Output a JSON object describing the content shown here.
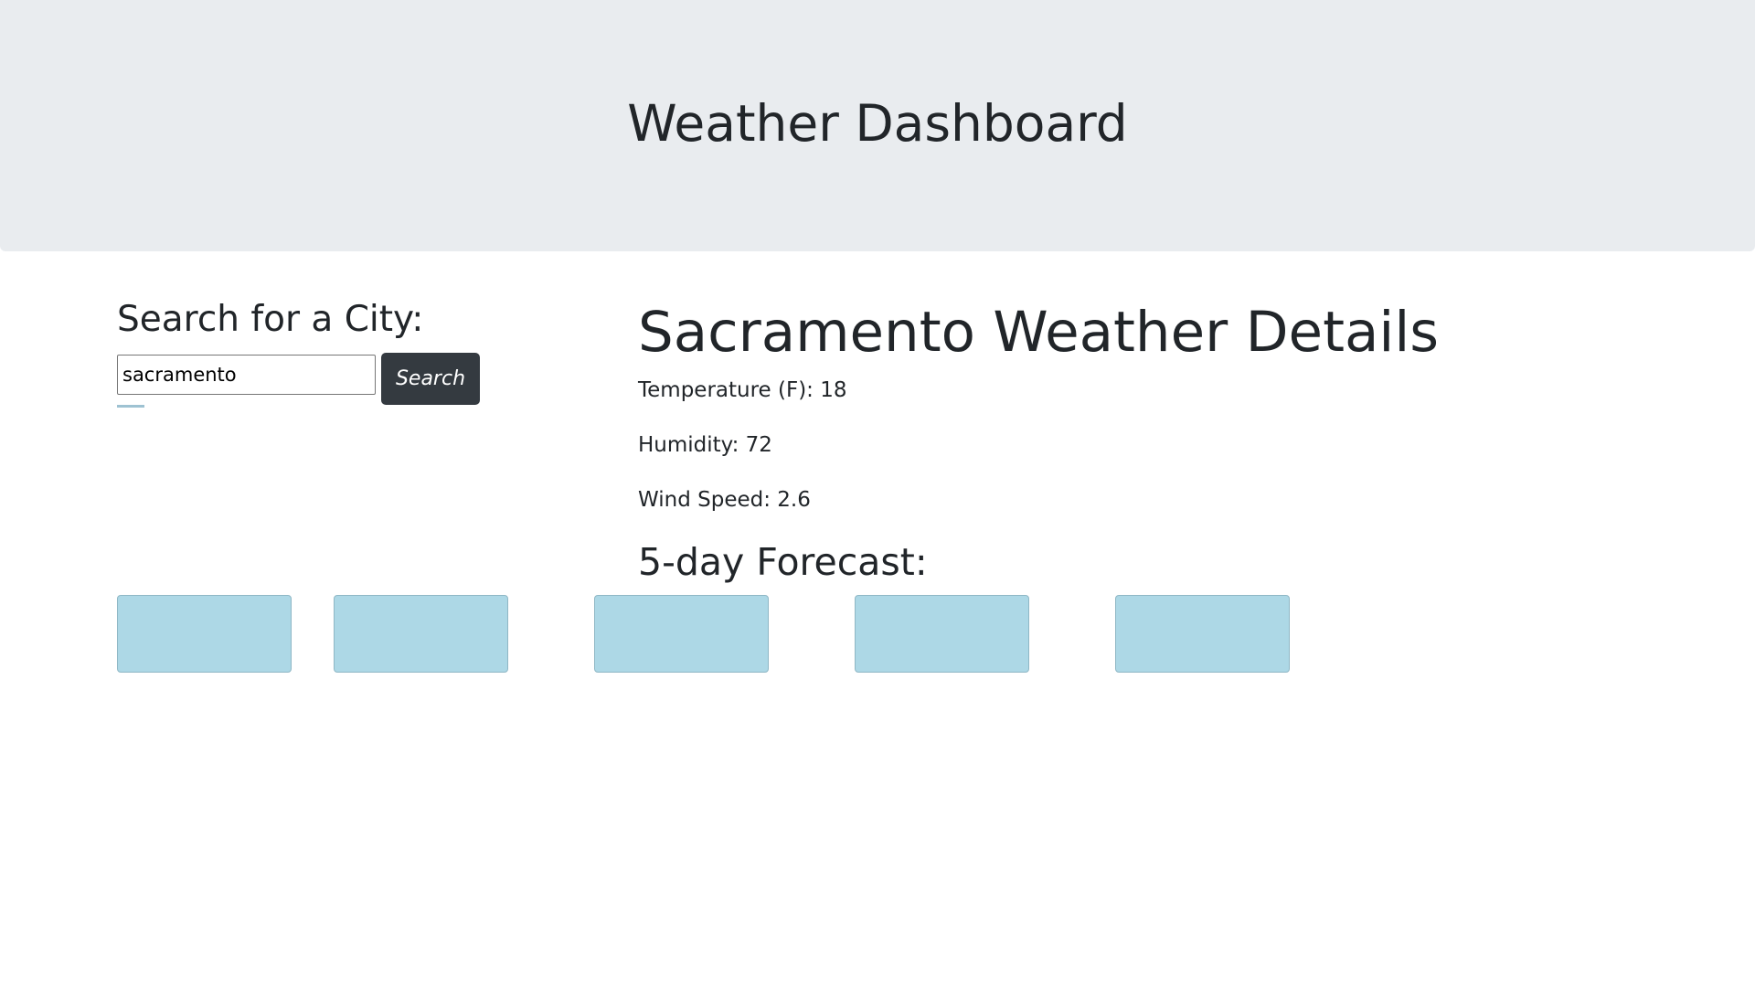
{
  "header": {
    "title": "Weather Dashboard"
  },
  "search": {
    "heading": "Search for a City:",
    "value": "sacramento",
    "button_label": "Search"
  },
  "details": {
    "title": "Sacramento Weather Details",
    "temperature": "Temperature (F): 18",
    "humidity": "Humidity: 72",
    "wind_speed": "Wind Speed: 2.6"
  },
  "forecast": {
    "heading": "5-day Forecast:",
    "card_color": "#add8e6"
  }
}
